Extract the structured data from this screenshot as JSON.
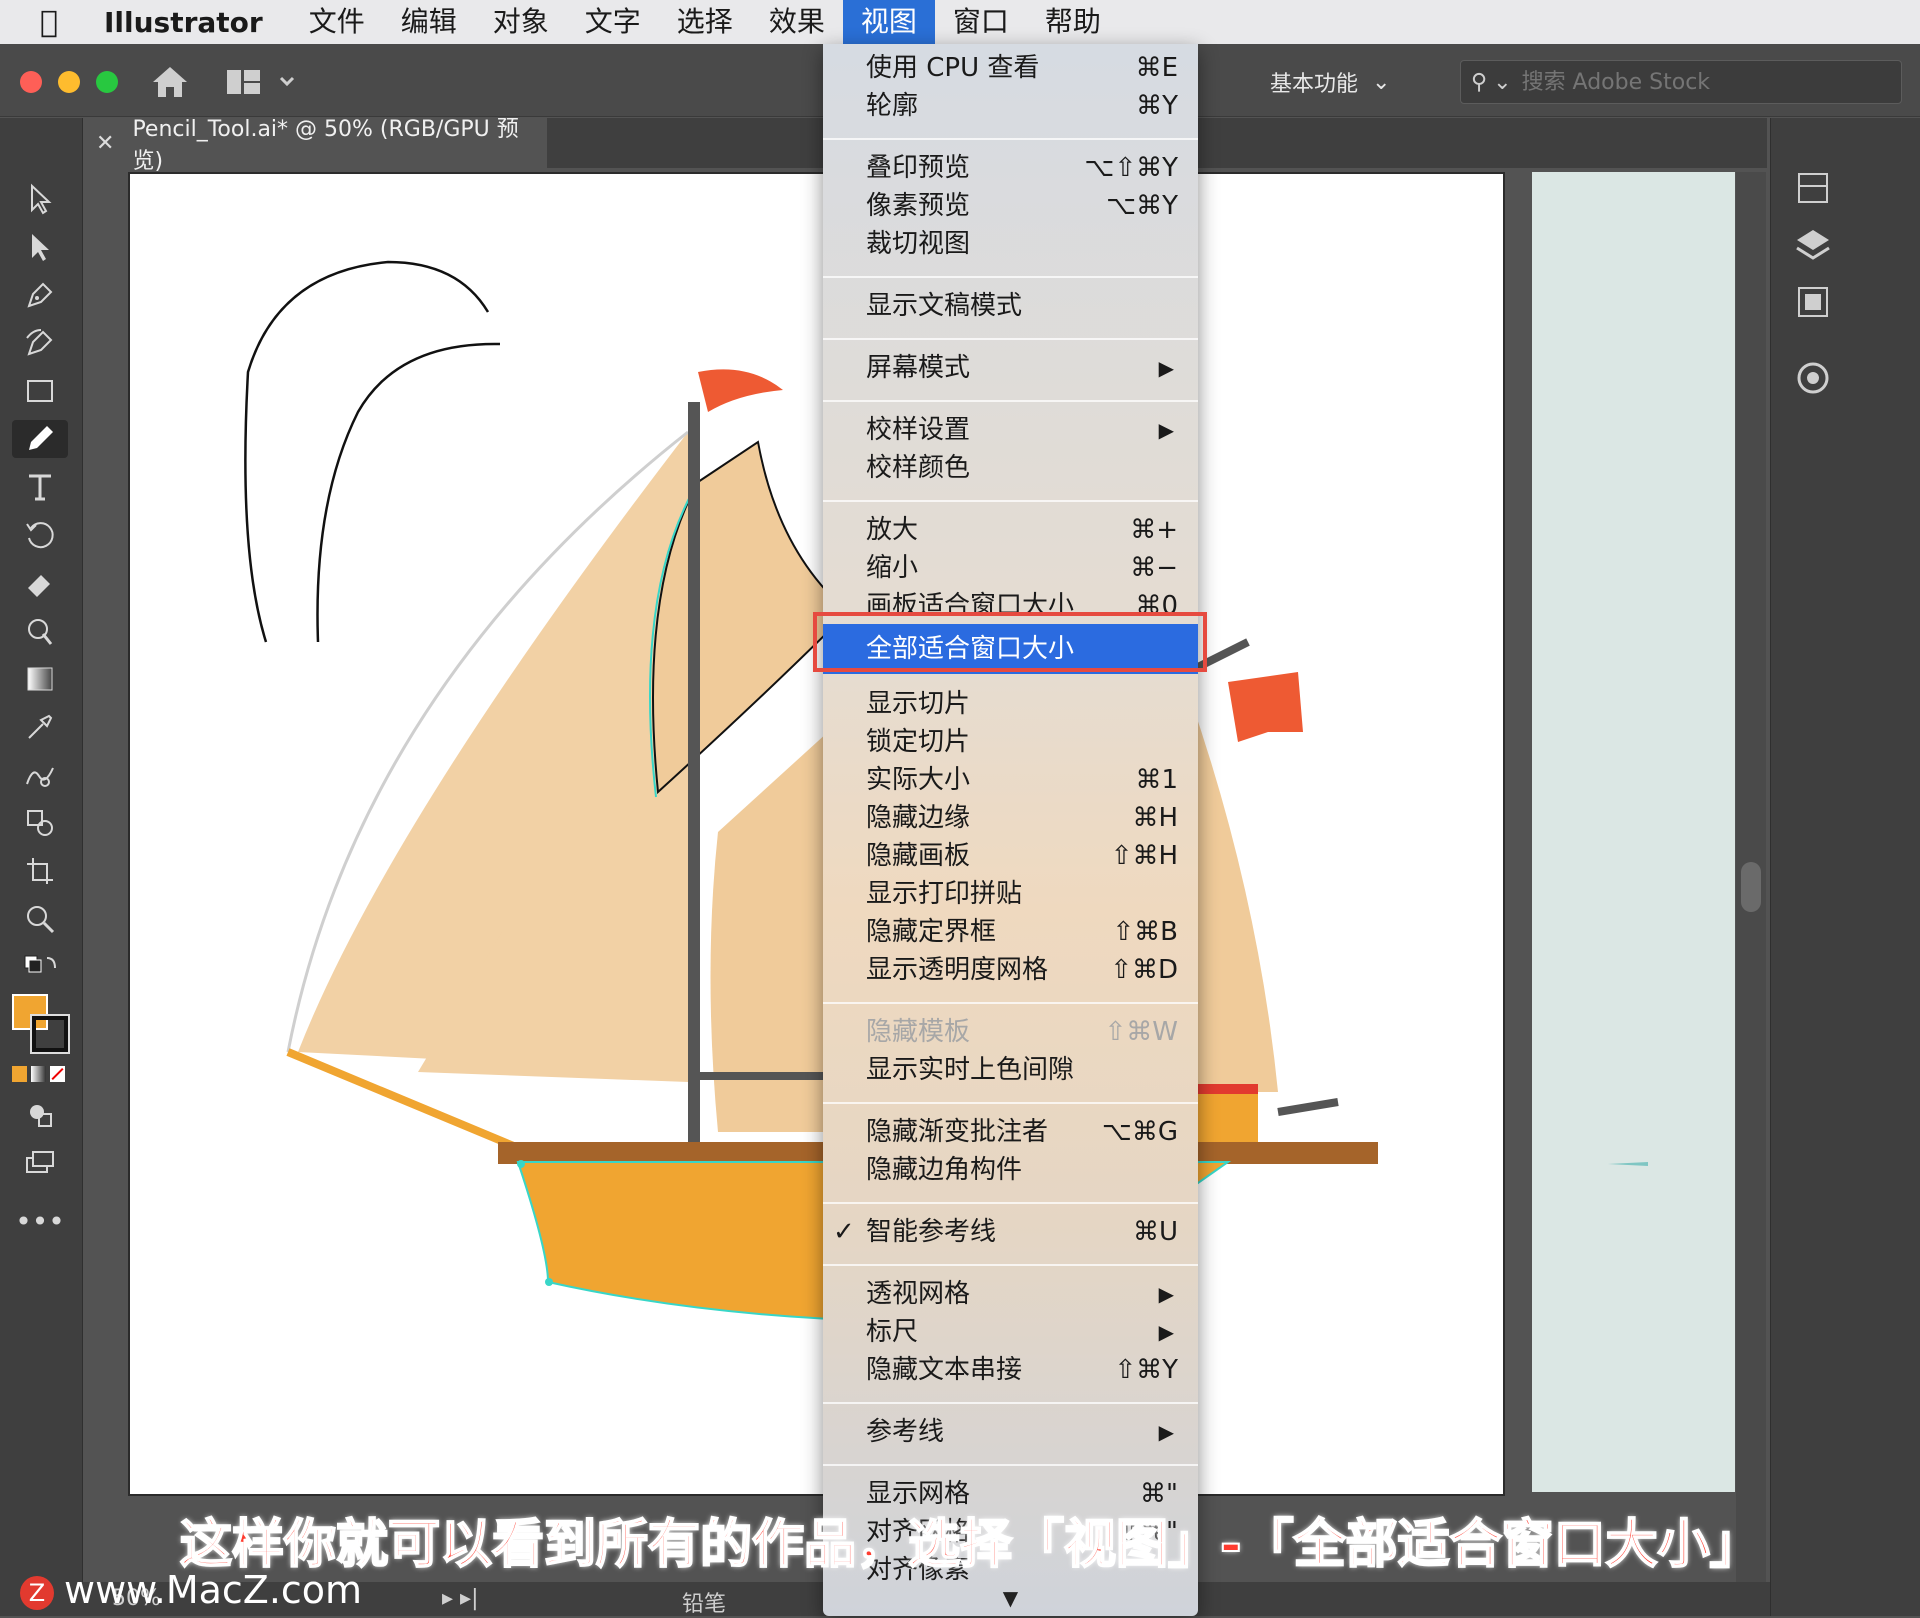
{
  "menubar": {
    "app_name": "Illustrator",
    "items": [
      "文件",
      "编辑",
      "对象",
      "文字",
      "选择",
      "效果",
      "视图",
      "窗口",
      "帮助"
    ],
    "active": "视图"
  },
  "toolbar": {
    "workspace": "基本功能",
    "search_placeholder": "搜索 Adobe Stock"
  },
  "document": {
    "tab_title": "Pencil_Tool.ai* @ 50% (RGB/GPU 预览)"
  },
  "statusbar": {
    "zoom": "50%",
    "tool": "铅笔"
  },
  "view_menu": {
    "items": [
      {
        "label": "使用 CPU 查看",
        "shortcut": "⌘E"
      },
      {
        "label": "轮廓",
        "shortcut": "⌘Y"
      },
      {
        "label": "叠印预览",
        "shortcut": "⌥⇧⌘Y"
      },
      {
        "label": "像素预览",
        "shortcut": "⌥⌘Y"
      },
      {
        "label": "裁切视图",
        "shortcut": ""
      },
      {
        "label": "显示文稿模式",
        "shortcut": ""
      },
      {
        "label": "屏幕模式",
        "shortcut": "▶"
      },
      {
        "label": "校样设置",
        "shortcut": "▶"
      },
      {
        "label": "校样颜色",
        "shortcut": ""
      },
      {
        "label": "放大",
        "shortcut": "⌘+"
      },
      {
        "label": "缩小",
        "shortcut": "⌘−"
      },
      {
        "label": "画板适合窗口大小",
        "shortcut": "⌘0"
      },
      {
        "label": "全部适合窗口大小",
        "shortcut": ""
      },
      {
        "label": "显示切片",
        "shortcut": ""
      },
      {
        "label": "锁定切片",
        "shortcut": ""
      },
      {
        "label": "实际大小",
        "shortcut": "⌘1"
      },
      {
        "label": "隐藏边缘",
        "shortcut": "⌘H"
      },
      {
        "label": "隐藏画板",
        "shortcut": "⇧⌘H"
      },
      {
        "label": "显示打印拼贴",
        "shortcut": ""
      },
      {
        "label": "隐藏定界框",
        "shortcut": "⇧⌘B"
      },
      {
        "label": "显示透明度网格",
        "shortcut": "⇧⌘D"
      },
      {
        "label": "隐藏模板",
        "shortcut": "⇧⌘W"
      },
      {
        "label": "显示实时上色间隙",
        "shortcut": ""
      },
      {
        "label": "隐藏渐变批注者",
        "shortcut": "⌥⌘G"
      },
      {
        "label": "隐藏边角构件",
        "shortcut": ""
      },
      {
        "label": "智能参考线",
        "shortcut": "⌘U",
        "check": "✓"
      },
      {
        "label": "透视网格",
        "shortcut": "▶"
      },
      {
        "label": "标尺",
        "shortcut": "▶"
      },
      {
        "label": "隐藏文本串接",
        "shortcut": "⇧⌘Y"
      },
      {
        "label": "参考线",
        "shortcut": "▶"
      },
      {
        "label": "显示网格",
        "shortcut": "⌘\""
      },
      {
        "label": "对齐网格",
        "shortcut": "⇧⌘\""
      },
      {
        "label": "对齐像素",
        "shortcut": ""
      }
    ],
    "more_arrow": "▼"
  },
  "caption": "这样你就可以看到所有的作品，选择「视图」-「全部适合窗口大小」",
  "watermark": "www.MacZ.com",
  "watermark_logo": "Z",
  "colors": {
    "menu_highlight": "#2b6be0",
    "highlight_border": "#e64a3f",
    "caption": "#ff3b2f",
    "sail": "#f0cb9a",
    "hull": "#f0a531",
    "flag": "#ee5a33"
  }
}
